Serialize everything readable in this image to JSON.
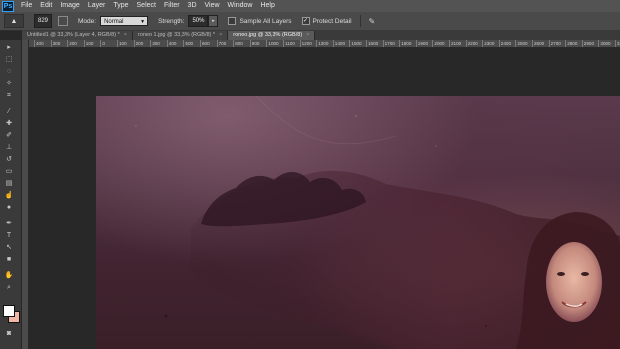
{
  "app": {
    "logo": "Ps"
  },
  "menu": [
    "File",
    "Edit",
    "Image",
    "Layer",
    "Type",
    "Select",
    "Filter",
    "3D",
    "View",
    "Window",
    "Help"
  ],
  "options": {
    "brush_size": "829",
    "mode_label": "Mode:",
    "mode_value": "Normal",
    "strength_label": "Strength:",
    "strength_value": "50%",
    "sample_all_layers": "Sample All Layers",
    "protect_detail": "Protect Detail"
  },
  "tabs": [
    {
      "label": "Untitled1 @ 33,3% (Layer 4, RGB/8) *",
      "active": false
    },
    {
      "label": "roneo 1.jpg @ 33,3% (RGB/8) *",
      "active": false
    },
    {
      "label": "roneo.jpg @ 33,3% (RGB/8)",
      "active": true
    }
  ],
  "ruler_labels": [
    "400",
    "300",
    "200",
    "100",
    "0",
    "100",
    "200",
    "300",
    "400",
    "500",
    "600",
    "700",
    "800",
    "900",
    "1000",
    "1100",
    "1200",
    "1300",
    "1400",
    "1500",
    "1600",
    "1700",
    "1800",
    "1900",
    "2000",
    "2100",
    "2200",
    "2300",
    "2400",
    "2500",
    "2600",
    "2700",
    "2800",
    "2900",
    "3000",
    "3100"
  ],
  "colors": {
    "foreground": "#ffffff",
    "background": "#f2b6a6",
    "ps_blue": "#3fb0ff"
  }
}
